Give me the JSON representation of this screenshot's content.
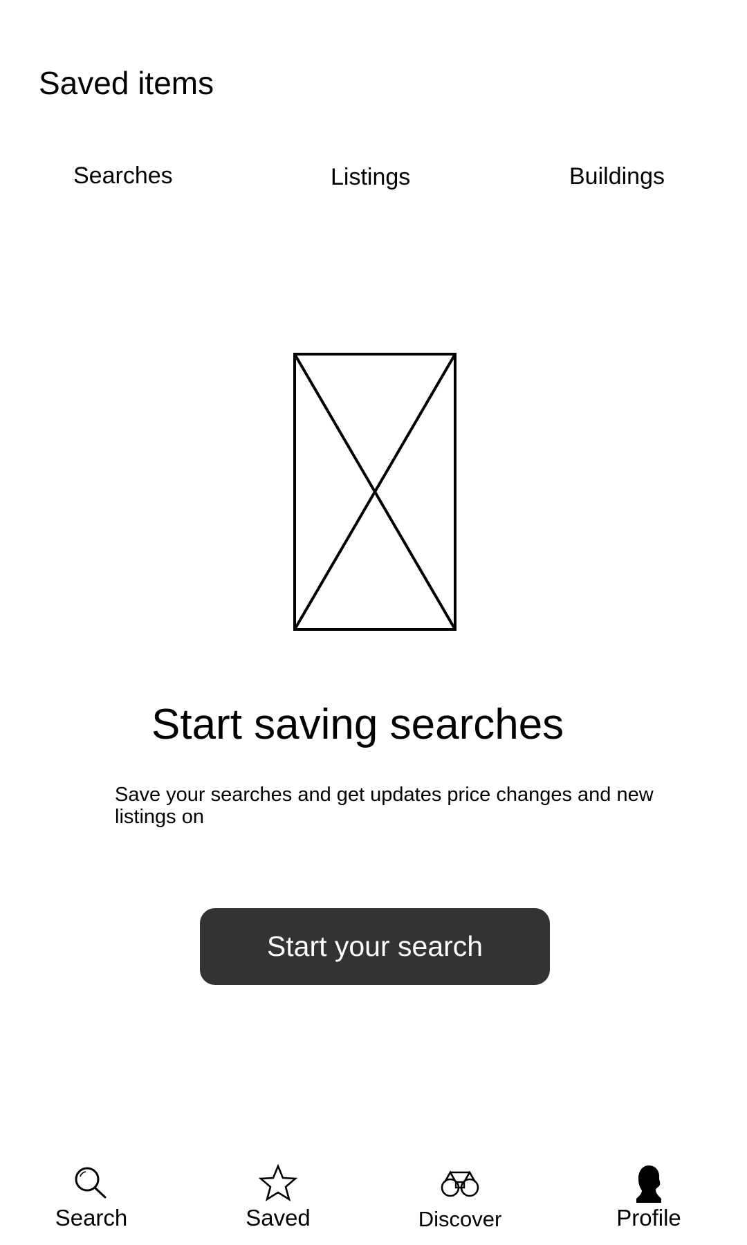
{
  "header": {
    "title": "Saved items"
  },
  "tabs": [
    {
      "label": "Searches"
    },
    {
      "label": "Listings"
    },
    {
      "label": "Buildings"
    }
  ],
  "empty_state": {
    "image_icon": "image-placeholder-icon",
    "title": "Start saving searches",
    "description": "Save your searches and get updates price changes and new listings on",
    "cta_label": "Start your search"
  },
  "bottom_nav": [
    {
      "label": "Search",
      "icon": "search-icon"
    },
    {
      "label": "Saved",
      "icon": "star-icon"
    },
    {
      "label": "Discover",
      "icon": "binoculars-icon"
    },
    {
      "label": "Profile",
      "icon": "profile-icon"
    }
  ],
  "colors": {
    "background": "#ffffff",
    "text": "#000000",
    "button_bg": "#333333",
    "button_text": "#ffffff"
  }
}
